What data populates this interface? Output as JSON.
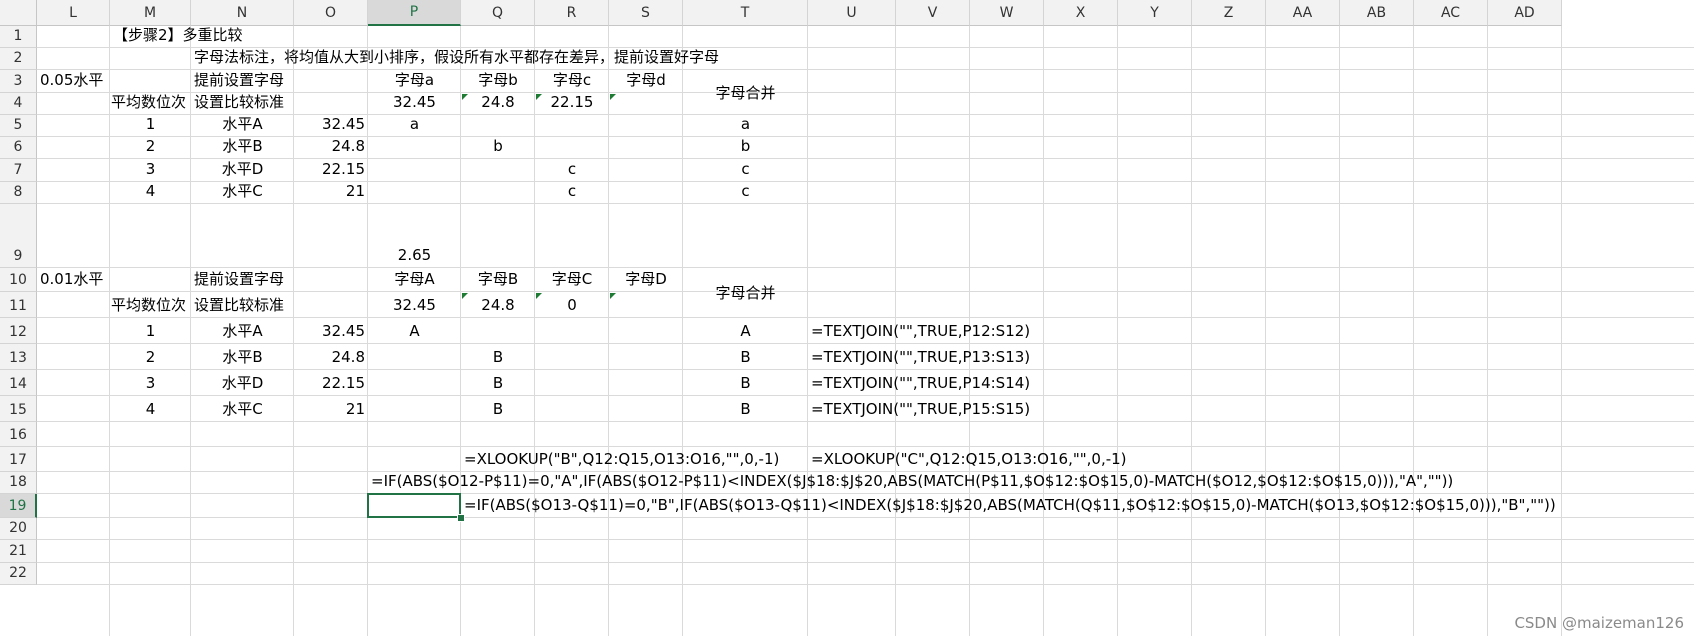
{
  "columns": [
    "L",
    "M",
    "N",
    "O",
    "P",
    "Q",
    "R",
    "S",
    "T",
    "U",
    "V",
    "W",
    "X",
    "Y",
    "Z",
    "AA",
    "AB",
    "AC",
    "AD"
  ],
  "selected_column": "P",
  "rows": [
    "1",
    "2",
    "3",
    "4",
    "5",
    "6",
    "7",
    "8",
    "9",
    "10",
    "11",
    "12",
    "13",
    "14",
    "15",
    "16",
    "17",
    "18",
    "19",
    "20",
    "21",
    "22"
  ],
  "selected_row": "19",
  "cells": {
    "M1": "【步骤2】多重比较",
    "N2": "字母法标注，将均值从大到小排序，假设所有水平都存在差异，提前设置好字母",
    "L3": "0.05水平",
    "N3": "提前设置字母",
    "P3": "字母a",
    "Q3": "字母b",
    "R3": "字母c",
    "S3": "字母d",
    "T3": "字母合并",
    "M4": "平均数位次",
    "N4": "设置比较标准",
    "P4": "32.45",
    "Q4": "24.8",
    "R4": "22.15",
    "M5": "1",
    "N5": "水平A",
    "O5": "32.45",
    "P5": "a",
    "T5": "a",
    "M6": "2",
    "N6": "水平B",
    "O6": "24.8",
    "Q6": "b",
    "T6": "b",
    "M7": "3",
    "N7": "水平D",
    "O7": "22.15",
    "R7": "c",
    "T7": "c",
    "M8": "4",
    "N8": "水平C",
    "O8": "21",
    "R8": "c",
    "T8": "c",
    "P9": "2.65",
    "L10": "0.01水平",
    "N10": "提前设置字母",
    "P10": "字母A",
    "Q10": "字母B",
    "R10": "字母C",
    "S10": "字母D",
    "T10": "字母合并",
    "M11": "平均数位次",
    "N11": "设置比较标准",
    "P11": "32.45",
    "Q11": "24.8",
    "R11": "0",
    "M12": "1",
    "N12": "水平A",
    "O12": "32.45",
    "P12": "A",
    "T12": "A",
    "U12": "=TEXTJOIN(\"\",TRUE,P12:S12)",
    "M13": "2",
    "N13": "水平B",
    "O13": "24.8",
    "Q13": "B",
    "T13": "B",
    "U13": "=TEXTJOIN(\"\",TRUE,P13:S13)",
    "M14": "3",
    "N14": "水平D",
    "O14": "22.15",
    "Q14": "B",
    "T14": "B",
    "U14": "=TEXTJOIN(\"\",TRUE,P14:S14)",
    "M15": "4",
    "N15": "水平C",
    "O15": "21",
    "Q15": "B",
    "T15": "B",
    "U15": "=TEXTJOIN(\"\",TRUE,P15:S15)",
    "Q17": "=XLOOKUP(\"B\",Q12:Q15,O13:O16,\"\",0,-1)",
    "U17": "=XLOOKUP(\"C\",Q12:Q15,O13:O16,\"\",0,-1)",
    "P18": "=IF(ABS($O12-P$11)=0,\"A\",IF(ABS($O12-P$11)<INDEX($J$18:$J$20,ABS(MATCH(P$11,$O$12:$O$15,0)-MATCH($O12,$O$12:$O$15,0))),\"A\",\"\"))",
    "Q19": "=IF(ABS($O13-Q$11)=0,\"B\",IF(ABS($O13-Q$11)<INDEX($J$18:$J$20,ABS(MATCH(Q$11,$O$12:$O$15,0)-MATCH($O13,$O$12:$O$15,0))),\"B\",\"\"))"
  },
  "watermark": "CSDN @maizeman126"
}
